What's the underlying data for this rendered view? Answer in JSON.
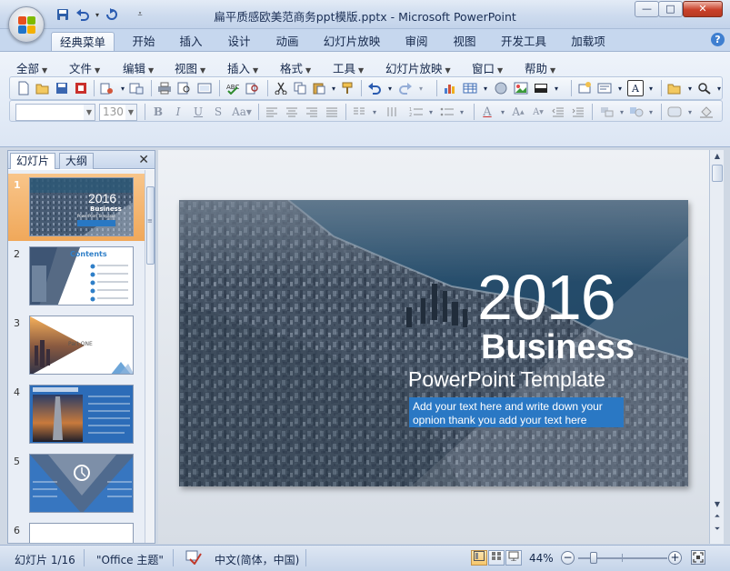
{
  "window": {
    "title": "扁平质感欧美范商务ppt模版.pptx - Microsoft PowerPoint",
    "controls": {
      "minimize": "—",
      "maximize": "□",
      "close": "✕"
    }
  },
  "ribbon_tabs": [
    "经典菜单",
    "开始",
    "插入",
    "设计",
    "动画",
    "幻灯片放映",
    "审阅",
    "视图",
    "开发工具",
    "加载项"
  ],
  "active_tab": "经典菜单",
  "menus": [
    "全部",
    "文件",
    "编辑",
    "视图",
    "插入",
    "格式",
    "工具",
    "幻灯片放映",
    "窗口",
    "帮助"
  ],
  "format_bar": {
    "font_name": "",
    "font_size": "130"
  },
  "left_pane": {
    "tabs": [
      "幻灯片",
      "大纲"
    ],
    "close": "✕",
    "slides": [
      {
        "num": "1",
        "year": "2016",
        "line1": "Business",
        "line2": "PowerPoint Template"
      },
      {
        "num": "2",
        "title": "Contents"
      },
      {
        "num": "3",
        "label": "Part ONE"
      },
      {
        "num": "4"
      },
      {
        "num": "5"
      },
      {
        "num": "6"
      }
    ]
  },
  "slide": {
    "year": "2016",
    "title": "Business",
    "subtitle": "PowerPoint Template",
    "body_line1": "Add your text here and write down your",
    "body_line2": "opnion thank you add your text here"
  },
  "status": {
    "slide_info": "幻灯片 1/16",
    "theme": "\"Office 主题\"",
    "language": "中文(简体，中国)",
    "zoom": "44%",
    "zoom_minus": "−",
    "zoom_plus": "+"
  }
}
